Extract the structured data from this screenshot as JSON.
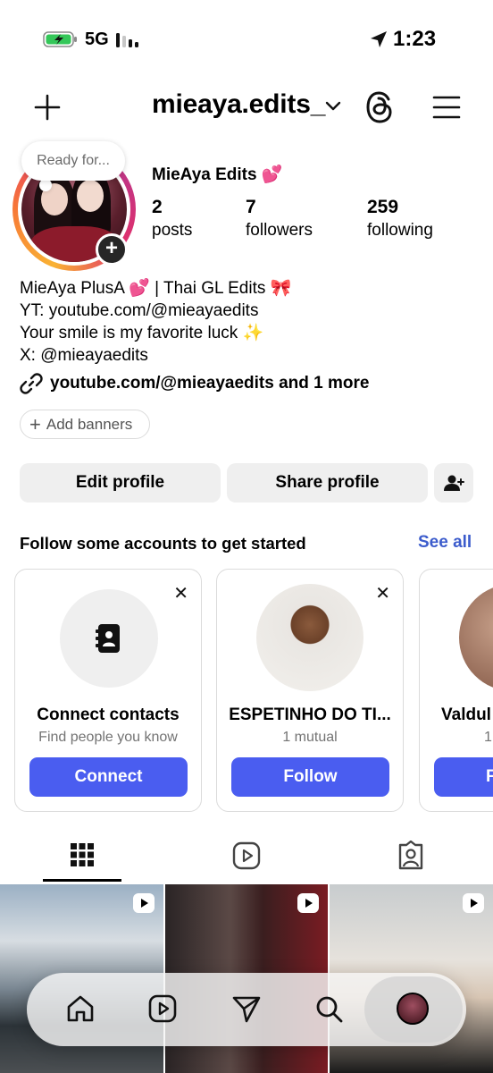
{
  "status_bar": {
    "network": "5G",
    "time": "1:23"
  },
  "header": {
    "username": "mieaya.edits_",
    "icons": [
      "plus-icon",
      "chevron-down-icon",
      "threads-icon",
      "menu-icon"
    ]
  },
  "profile": {
    "note": "Ready for...",
    "display_name": "MieAya Edits 💕",
    "stats": [
      {
        "value": "2",
        "label": "posts"
      },
      {
        "value": "7",
        "label": "followers"
      },
      {
        "value": "259",
        "label": "following"
      }
    ],
    "bio": [
      "MieAya PlusA 💕 | Thai GL Edits 🎀",
      "YT: youtube.com/@mieayaedits",
      "Your smile is my favorite luck ✨",
      "X: @mieayaedits"
    ],
    "link": "youtube.com/@mieayaedits and 1 more",
    "add_banners": "Add banners"
  },
  "actions": {
    "edit_profile": "Edit profile",
    "share_profile": "Share profile"
  },
  "suggestions": {
    "title": "Follow some accounts to get started",
    "see_all": "See all",
    "cards": [
      {
        "name": "Connect contacts",
        "sub": "Find people you know",
        "button": "Connect"
      },
      {
        "name": "ESPETINHO DO TI...",
        "sub": "1 mutual",
        "button": "Follow"
      },
      {
        "name": "Valdul",
        "sub": "1",
        "button": "F"
      }
    ]
  },
  "tabs": [
    "grid-icon",
    "reels-icon",
    "tagged-icon"
  ],
  "bottom_nav": [
    "home-icon",
    "reels-icon",
    "send-icon",
    "search-icon",
    "profile-avatar"
  ],
  "colors": {
    "accent_blue": "#4a5df0",
    "link_blue": "#3c5ccc",
    "button_grey": "#efefef"
  }
}
